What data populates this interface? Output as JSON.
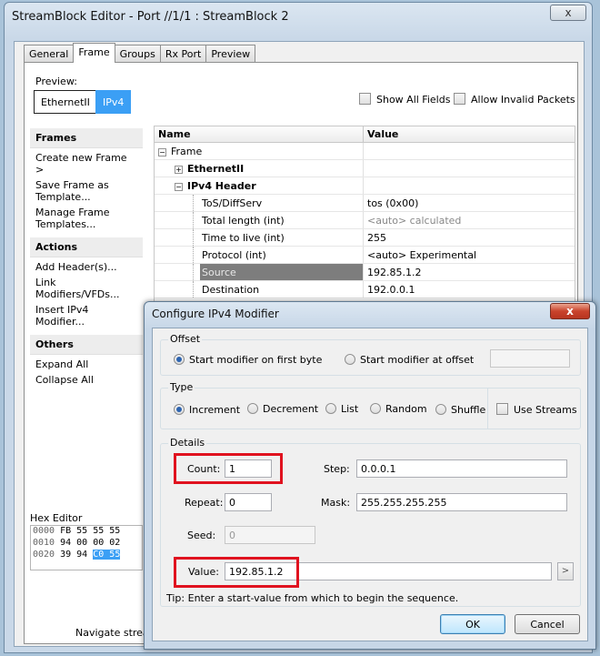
{
  "window": {
    "title": "StreamBlock Editor - Port //1/1 : StreamBlock 2",
    "close_glyph": "x"
  },
  "tabs": [
    "General",
    "Frame",
    "Groups",
    "Rx Port",
    "Preview"
  ],
  "active_tab": "Frame",
  "preview": {
    "label": "Preview:",
    "buttons": [
      "EthernetII",
      "IPv4"
    ],
    "show_all_fields": "Show All Fields",
    "allow_invalid_packets": "Allow Invalid Packets"
  },
  "sidebar": {
    "frames": {
      "title": "Frames",
      "items": [
        "Create new Frame >",
        "Save Frame as Template...",
        "Manage Frame Templates..."
      ]
    },
    "actions": {
      "title": "Actions",
      "items": [
        "Add Header(s)...",
        "Link Modifiers/VFDs...",
        "Insert IPv4 Modifier..."
      ]
    },
    "others": {
      "title": "Others",
      "items": [
        "Expand All",
        "Collapse All"
      ]
    }
  },
  "hex_editor": {
    "title": "Hex Editor",
    "rows": [
      {
        "offset": "0000",
        "bytes": "FB 55 55 55"
      },
      {
        "offset": "0010",
        "bytes": "94 00 00 02"
      },
      {
        "offset": "0020",
        "bytes": "39 94",
        "selected": "C0 55"
      }
    ]
  },
  "navigate_text": "Navigate strea",
  "tree": {
    "col_name": "Name",
    "col_value": "Value",
    "frame": "Frame",
    "ethernet": "EthernetII",
    "ipv4_header": "IPv4 Header",
    "fields": [
      {
        "name": "ToS/DiffServ",
        "value": "tos (0x00)"
      },
      {
        "name": "Total length (int)",
        "value": "<auto> calculated"
      },
      {
        "name": "Time to live (int)",
        "value": "255"
      },
      {
        "name": "Protocol (int)",
        "value": "<auto> Experimental"
      },
      {
        "name": "Source",
        "value": "192.85.1.2"
      },
      {
        "name": "Destination",
        "value": "192.0.0.1"
      }
    ]
  },
  "dialog": {
    "title": "Configure IPv4 Modifier",
    "close_glyph": "x",
    "offset": {
      "label": "Offset",
      "opt_first_byte": "Start modifier on first byte",
      "opt_at_offset": "Start modifier at offset"
    },
    "type": {
      "label": "Type",
      "options": [
        "Increment",
        "Decrement",
        "List",
        "Random",
        "Shuffle"
      ],
      "selected": "Increment",
      "use_streams": "Use Streams"
    },
    "details": {
      "label": "Details",
      "count_label": "Count:",
      "count": "1",
      "step_label": "Step:",
      "step": "0.0.0.1",
      "repeat_label": "Repeat:",
      "repeat": "0",
      "mask_label": "Mask:",
      "mask": "255.255.255.255",
      "seed_label": "Seed:",
      "seed": "0",
      "value_label": "Value:",
      "value": "192.85.1.2"
    },
    "tip": "Tip:  Enter a start-value from which to begin the sequence.",
    "ok": "OK",
    "cancel": "Cancel"
  }
}
